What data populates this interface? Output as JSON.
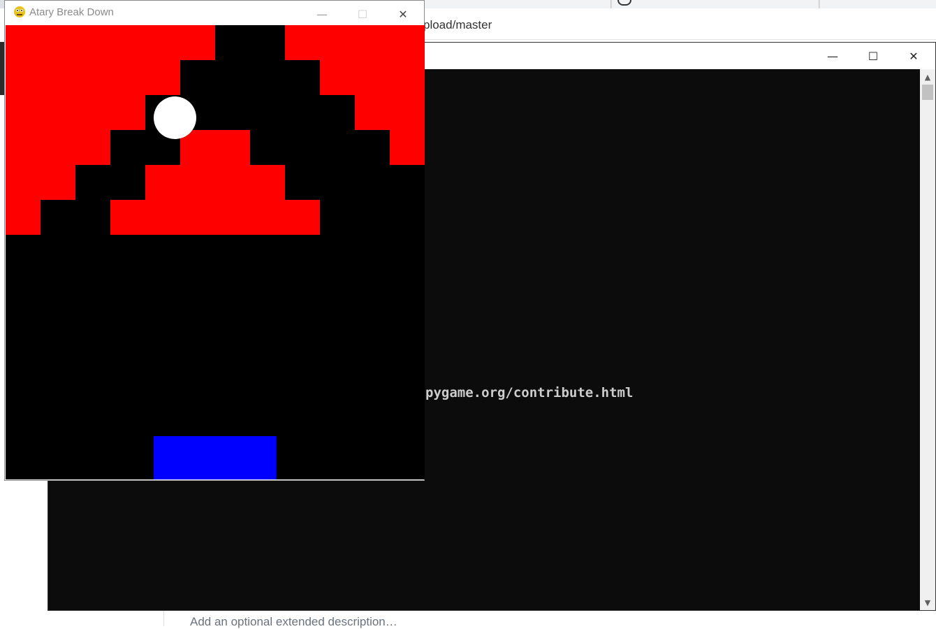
{
  "browser": {
    "address_text": "pload/master",
    "description_placeholder": "Add an optional extended description…"
  },
  "console": {
    "text_line": "pygame.org/contribute.html",
    "minimize_icon": "minimize-icon",
    "maximize_icon": "maximize-icon",
    "close_icon": "close-icon",
    "background_color": "#0c0c0c",
    "text_color": "#cccccc"
  },
  "game": {
    "title": "Atary Break Down",
    "icon": "pygame-snake-icon",
    "brick_color": "#ff0000",
    "ball_color": "#ffffff",
    "paddle_color": "#0000ff",
    "background_color": "#000000"
  }
}
